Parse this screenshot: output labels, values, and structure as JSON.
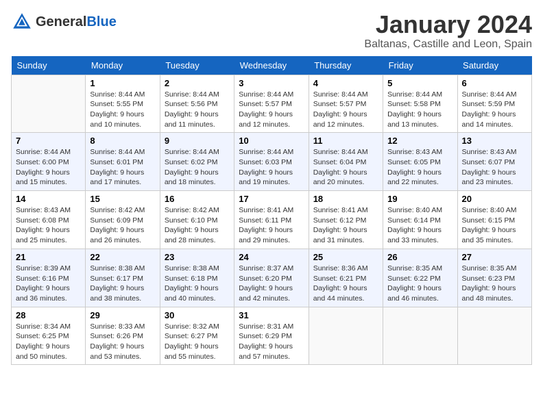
{
  "header": {
    "logo_general": "General",
    "logo_blue": "Blue",
    "title": "January 2024",
    "subtitle": "Baltanas, Castille and Leon, Spain"
  },
  "days_of_week": [
    "Sunday",
    "Monday",
    "Tuesday",
    "Wednesday",
    "Thursday",
    "Friday",
    "Saturday"
  ],
  "weeks": [
    [
      {
        "day": null
      },
      {
        "day": "1",
        "sunrise": "Sunrise: 8:44 AM",
        "sunset": "Sunset: 5:55 PM",
        "daylight": "Daylight: 9 hours and 10 minutes."
      },
      {
        "day": "2",
        "sunrise": "Sunrise: 8:44 AM",
        "sunset": "Sunset: 5:56 PM",
        "daylight": "Daylight: 9 hours and 11 minutes."
      },
      {
        "day": "3",
        "sunrise": "Sunrise: 8:44 AM",
        "sunset": "Sunset: 5:57 PM",
        "daylight": "Daylight: 9 hours and 12 minutes."
      },
      {
        "day": "4",
        "sunrise": "Sunrise: 8:44 AM",
        "sunset": "Sunset: 5:57 PM",
        "daylight": "Daylight: 9 hours and 12 minutes."
      },
      {
        "day": "5",
        "sunrise": "Sunrise: 8:44 AM",
        "sunset": "Sunset: 5:58 PM",
        "daylight": "Daylight: 9 hours and 13 minutes."
      },
      {
        "day": "6",
        "sunrise": "Sunrise: 8:44 AM",
        "sunset": "Sunset: 5:59 PM",
        "daylight": "Daylight: 9 hours and 14 minutes."
      }
    ],
    [
      {
        "day": "7",
        "sunrise": "Sunrise: 8:44 AM",
        "sunset": "Sunset: 6:00 PM",
        "daylight": "Daylight: 9 hours and 15 minutes."
      },
      {
        "day": "8",
        "sunrise": "Sunrise: 8:44 AM",
        "sunset": "Sunset: 6:01 PM",
        "daylight": "Daylight: 9 hours and 17 minutes."
      },
      {
        "day": "9",
        "sunrise": "Sunrise: 8:44 AM",
        "sunset": "Sunset: 6:02 PM",
        "daylight": "Daylight: 9 hours and 18 minutes."
      },
      {
        "day": "10",
        "sunrise": "Sunrise: 8:44 AM",
        "sunset": "Sunset: 6:03 PM",
        "daylight": "Daylight: 9 hours and 19 minutes."
      },
      {
        "day": "11",
        "sunrise": "Sunrise: 8:44 AM",
        "sunset": "Sunset: 6:04 PM",
        "daylight": "Daylight: 9 hours and 20 minutes."
      },
      {
        "day": "12",
        "sunrise": "Sunrise: 8:43 AM",
        "sunset": "Sunset: 6:05 PM",
        "daylight": "Daylight: 9 hours and 22 minutes."
      },
      {
        "day": "13",
        "sunrise": "Sunrise: 8:43 AM",
        "sunset": "Sunset: 6:07 PM",
        "daylight": "Daylight: 9 hours and 23 minutes."
      }
    ],
    [
      {
        "day": "14",
        "sunrise": "Sunrise: 8:43 AM",
        "sunset": "Sunset: 6:08 PM",
        "daylight": "Daylight: 9 hours and 25 minutes."
      },
      {
        "day": "15",
        "sunrise": "Sunrise: 8:42 AM",
        "sunset": "Sunset: 6:09 PM",
        "daylight": "Daylight: 9 hours and 26 minutes."
      },
      {
        "day": "16",
        "sunrise": "Sunrise: 8:42 AM",
        "sunset": "Sunset: 6:10 PM",
        "daylight": "Daylight: 9 hours and 28 minutes."
      },
      {
        "day": "17",
        "sunrise": "Sunrise: 8:41 AM",
        "sunset": "Sunset: 6:11 PM",
        "daylight": "Daylight: 9 hours and 29 minutes."
      },
      {
        "day": "18",
        "sunrise": "Sunrise: 8:41 AM",
        "sunset": "Sunset: 6:12 PM",
        "daylight": "Daylight: 9 hours and 31 minutes."
      },
      {
        "day": "19",
        "sunrise": "Sunrise: 8:40 AM",
        "sunset": "Sunset: 6:14 PM",
        "daylight": "Daylight: 9 hours and 33 minutes."
      },
      {
        "day": "20",
        "sunrise": "Sunrise: 8:40 AM",
        "sunset": "Sunset: 6:15 PM",
        "daylight": "Daylight: 9 hours and 35 minutes."
      }
    ],
    [
      {
        "day": "21",
        "sunrise": "Sunrise: 8:39 AM",
        "sunset": "Sunset: 6:16 PM",
        "daylight": "Daylight: 9 hours and 36 minutes."
      },
      {
        "day": "22",
        "sunrise": "Sunrise: 8:38 AM",
        "sunset": "Sunset: 6:17 PM",
        "daylight": "Daylight: 9 hours and 38 minutes."
      },
      {
        "day": "23",
        "sunrise": "Sunrise: 8:38 AM",
        "sunset": "Sunset: 6:18 PM",
        "daylight": "Daylight: 9 hours and 40 minutes."
      },
      {
        "day": "24",
        "sunrise": "Sunrise: 8:37 AM",
        "sunset": "Sunset: 6:20 PM",
        "daylight": "Daylight: 9 hours and 42 minutes."
      },
      {
        "day": "25",
        "sunrise": "Sunrise: 8:36 AM",
        "sunset": "Sunset: 6:21 PM",
        "daylight": "Daylight: 9 hours and 44 minutes."
      },
      {
        "day": "26",
        "sunrise": "Sunrise: 8:35 AM",
        "sunset": "Sunset: 6:22 PM",
        "daylight": "Daylight: 9 hours and 46 minutes."
      },
      {
        "day": "27",
        "sunrise": "Sunrise: 8:35 AM",
        "sunset": "Sunset: 6:23 PM",
        "daylight": "Daylight: 9 hours and 48 minutes."
      }
    ],
    [
      {
        "day": "28",
        "sunrise": "Sunrise: 8:34 AM",
        "sunset": "Sunset: 6:25 PM",
        "daylight": "Daylight: 9 hours and 50 minutes."
      },
      {
        "day": "29",
        "sunrise": "Sunrise: 8:33 AM",
        "sunset": "Sunset: 6:26 PM",
        "daylight": "Daylight: 9 hours and 53 minutes."
      },
      {
        "day": "30",
        "sunrise": "Sunrise: 8:32 AM",
        "sunset": "Sunset: 6:27 PM",
        "daylight": "Daylight: 9 hours and 55 minutes."
      },
      {
        "day": "31",
        "sunrise": "Sunrise: 8:31 AM",
        "sunset": "Sunset: 6:29 PM",
        "daylight": "Daylight: 9 hours and 57 minutes."
      },
      {
        "day": null
      },
      {
        "day": null
      },
      {
        "day": null
      }
    ]
  ]
}
